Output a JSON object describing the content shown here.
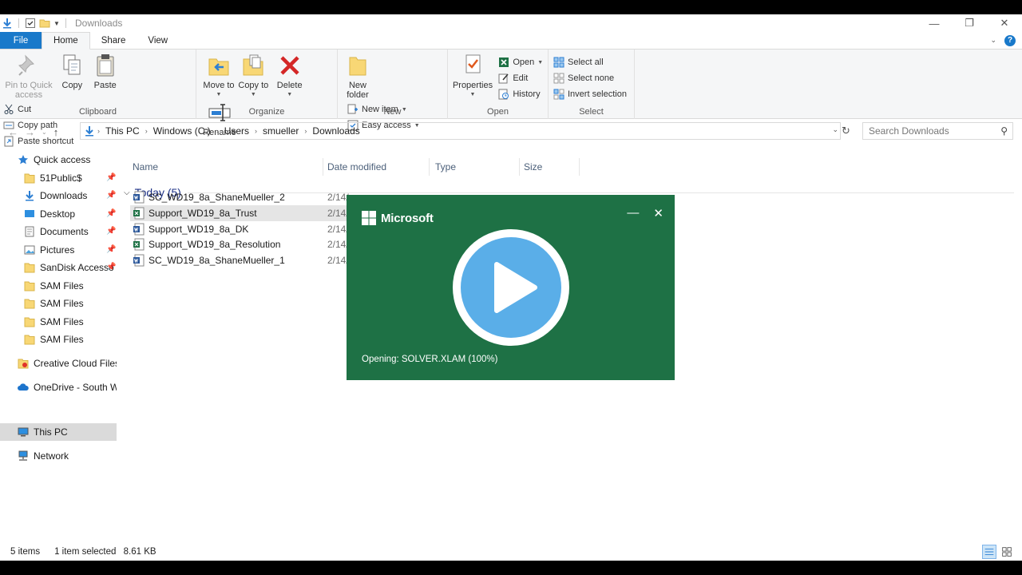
{
  "window": {
    "title": "Downloads",
    "controls": {
      "minimize": "—",
      "maximize": "❐",
      "close": "✕"
    }
  },
  "tabs": [
    "File",
    "Home",
    "Share",
    "View"
  ],
  "ribbon": {
    "clipboard": {
      "label": "Clipboard",
      "pin": "Pin to Quick access",
      "copy": "Copy",
      "paste": "Paste",
      "cut": "Cut",
      "copy_path": "Copy path",
      "paste_shortcut": "Paste shortcut"
    },
    "organize": {
      "label": "Organize",
      "move_to": "Move to",
      "copy_to": "Copy to",
      "delete": "Delete",
      "rename": "Rename"
    },
    "new": {
      "label": "New",
      "new_folder": "New folder",
      "new_item": "New item",
      "easy_access": "Easy access"
    },
    "open": {
      "label": "Open",
      "properties": "Properties",
      "open": "Open",
      "edit": "Edit",
      "history": "History"
    },
    "select": {
      "label": "Select",
      "select_all": "Select all",
      "select_none": "Select none",
      "invert": "Invert selection"
    }
  },
  "address": {
    "crumbs": [
      "This PC",
      "Windows (C:)",
      "Users",
      "smueller",
      "Downloads"
    ],
    "search_placeholder": "Search Downloads"
  },
  "nav": {
    "quick_access": "Quick access",
    "items": [
      {
        "label": "51Public$",
        "icon": "folder-icon"
      },
      {
        "label": "Downloads",
        "icon": "downloads-icon"
      },
      {
        "label": "Desktop",
        "icon": "desktop-icon"
      },
      {
        "label": "Documents",
        "icon": "documents-icon"
      },
      {
        "label": "Pictures",
        "icon": "pictures-icon"
      },
      {
        "label": "SanDisk Accesso",
        "icon": "folder-icon"
      },
      {
        "label": "SAM Files",
        "icon": "folder-icon"
      },
      {
        "label": "SAM Files",
        "icon": "folder-icon"
      },
      {
        "label": "SAM Files",
        "icon": "folder-icon"
      },
      {
        "label": "SAM Files",
        "icon": "folder-icon"
      }
    ],
    "creative_cloud": "Creative Cloud Files",
    "onedrive": "OneDrive - South Wa",
    "this_pc": "This PC",
    "network": "Network"
  },
  "columns": {
    "name": "Name",
    "date": "Date modified",
    "type": "Type",
    "size": "Size"
  },
  "group": {
    "label": "Today (5)"
  },
  "files": [
    {
      "name": "SC_WD19_8a_ShaneMueller_2",
      "date": "2/14/",
      "kind": "word"
    },
    {
      "name": "Support_WD19_8a_Trust",
      "date": "2/14/",
      "kind": "excel"
    },
    {
      "name": "Support_WD19_8a_DK",
      "date": "2/14/",
      "kind": "word"
    },
    {
      "name": "Support_WD19_8a_Resolution",
      "date": "2/14/",
      "kind": "excel"
    },
    {
      "name": "SC_WD19_8a_ShaneMueller_1",
      "date": "2/14/",
      "kind": "word"
    }
  ],
  "status": {
    "items": "5 items",
    "selected": "1 item selected",
    "size": "8.61 KB"
  },
  "splash": {
    "brand": "Microsoft",
    "status": "Opening: SOLVER.XLAM (100%)",
    "accent": "#1e7145",
    "play_color": "#5aaee8"
  }
}
